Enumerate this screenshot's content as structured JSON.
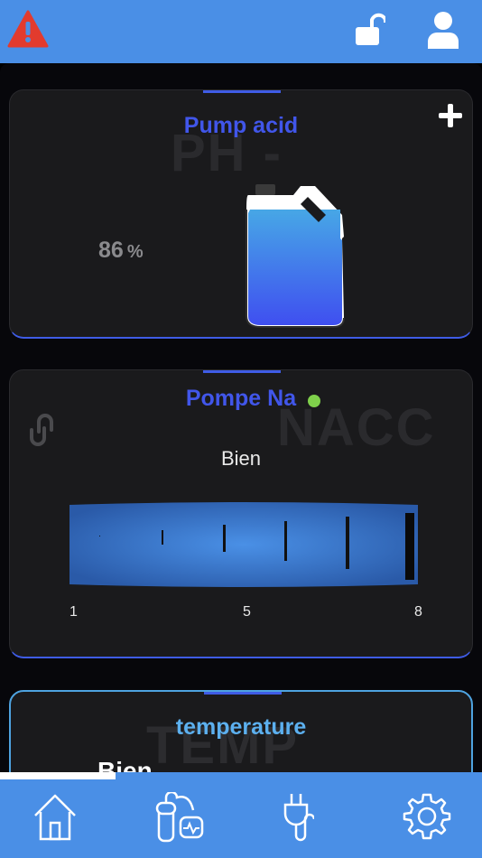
{
  "header": {
    "warning_icon": "warning-triangle-icon",
    "lock_icon": "unlock-icon",
    "user_icon": "user-icon"
  },
  "cards": {
    "pump_acid": {
      "watermark": "PH -",
      "title": "Pump acid",
      "level_value": "86",
      "level_unit": "%",
      "level_fraction": 0.86
    },
    "pompe_na": {
      "watermark": "NACC",
      "title": "Pompe Na",
      "status": "Bien",
      "scale": [
        "1",
        "5",
        "8"
      ],
      "status_dot_color": "#7fd04b"
    },
    "temperature": {
      "watermark": "TEMP",
      "title": "temperature",
      "status": "Bien"
    }
  },
  "bottom_nav": {
    "items": [
      "home-icon",
      "pump-icon",
      "plug-icon",
      "settings-icon"
    ]
  },
  "colors": {
    "accent": "#4a8fe6",
    "title_blue": "#4156ea",
    "warning": "#e23b2e"
  }
}
